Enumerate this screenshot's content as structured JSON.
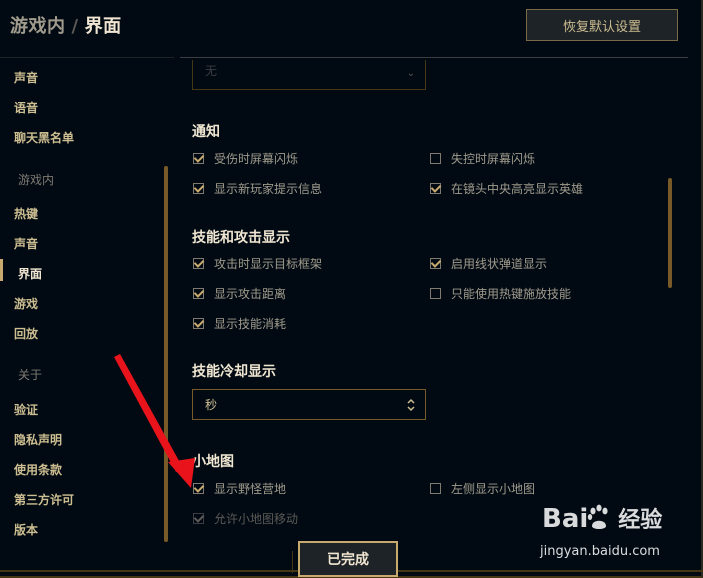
{
  "header": {
    "breadcrumb_section": "游戏内",
    "breadcrumb_separator": "/",
    "breadcrumb_page": "界面",
    "reset_button": "恢复默认设置"
  },
  "sidebar": {
    "top_items": [
      "声音",
      "语音",
      "聊天黑名单"
    ],
    "group_ingame": "游戏内",
    "ingame_items": [
      "热键",
      "声音",
      "界面",
      "游戏",
      "回放"
    ],
    "active_item": "界面",
    "group_about": "关于",
    "about_items": [
      "验证",
      "隐私声明",
      "使用条款",
      "第三方许可",
      "版本"
    ]
  },
  "content": {
    "top_select_value": "无",
    "notify": {
      "title": "通知",
      "options": [
        {
          "label": "受伤时屏幕闪烁",
          "checked": true
        },
        {
          "label": "失控时屏幕闪烁",
          "checked": false
        },
        {
          "label": "显示新玩家提示信息",
          "checked": true
        },
        {
          "label": "在镜头中央高亮显示英雄",
          "checked": true
        }
      ]
    },
    "ability": {
      "title": "技能和攻击显示",
      "options": [
        {
          "label": "攻击时显示目标框架",
          "checked": true
        },
        {
          "label": "启用线状弹道显示",
          "checked": true
        },
        {
          "label": "显示攻击距离",
          "checked": true
        },
        {
          "label": "只能使用热键施放技能",
          "checked": false
        },
        {
          "label": "显示技能消耗",
          "checked": true
        }
      ]
    },
    "cooldown": {
      "title": "技能冷却显示",
      "select_value": "秒"
    },
    "minimap": {
      "title": "小地图",
      "options": [
        {
          "label": "显示野怪营地",
          "checked": true
        },
        {
          "label": "左侧显示小地图",
          "checked": false
        },
        {
          "label": "允许小地图移动",
          "checked": true
        }
      ]
    }
  },
  "footer": {
    "done_button": "已完成"
  },
  "watermark": {
    "logo": "Bai 经验",
    "url": "jingyan.baidu.com"
  },
  "colors": {
    "background": "#010a13",
    "gold": "#c8aa6e",
    "gold_text": "#cdbe91",
    "annotation_arrow": "#e8131b"
  }
}
